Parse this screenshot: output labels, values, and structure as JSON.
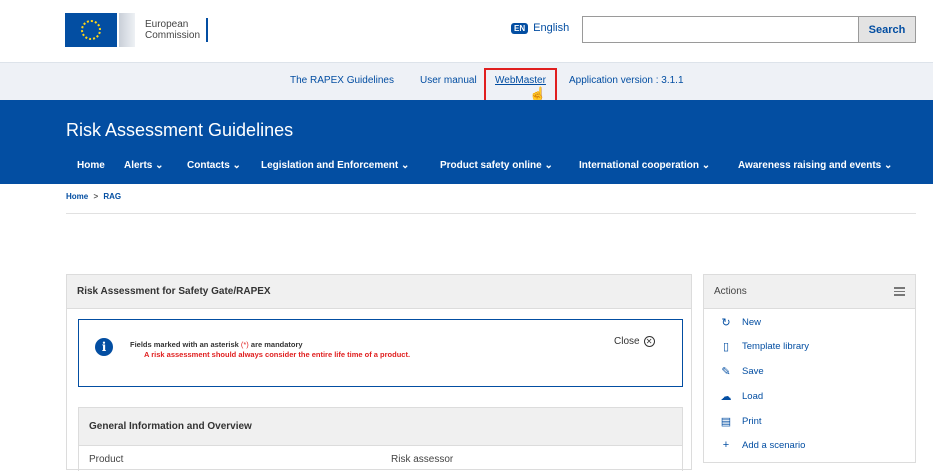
{
  "header": {
    "logo_line1": "European",
    "logo_line2": "Commission",
    "language_badge": "EN",
    "language_label": "English",
    "search_placeholder": "",
    "search_button": "Search"
  },
  "util_bar": {
    "links": [
      "The RAPEX Guidelines",
      "User manual",
      "WebMaster"
    ],
    "version": "Application version : 3.1.1"
  },
  "banner": {
    "title": "Risk Assessment Guidelines",
    "nav": [
      {
        "label": "Home"
      },
      {
        "label": "Alerts ⌄"
      },
      {
        "label": "Contacts ⌄"
      },
      {
        "label": "Legislation and Enforcement ⌄"
      },
      {
        "label": "Product safety online ⌄"
      },
      {
        "label": "International cooperation ⌄"
      },
      {
        "label": "Awareness raising and events ⌄"
      }
    ]
  },
  "breadcrumb": {
    "home": "Home",
    "separator": ">",
    "current": "RAG"
  },
  "main": {
    "panel_title": "Risk Assessment for Safety Gate/RAPEX",
    "info": {
      "line1_prefix": "Fields marked with an asterisk ",
      "asterisk": "(*)",
      "line1_suffix": " are mandatory",
      "line2": "A risk assessment should always consider the entire life time of a product.",
      "close_label": "Close"
    },
    "general": {
      "title": "General Information and Overview",
      "product_label": "Product",
      "assessor_label": "Risk assessor"
    }
  },
  "actions": {
    "title": "Actions",
    "items": [
      {
        "label": "New",
        "icon": "refresh-icon"
      },
      {
        "label": "Template library",
        "icon": "book-icon"
      },
      {
        "label": "Save",
        "icon": "pencil-icon"
      },
      {
        "label": "Load",
        "icon": "cloud-upload-icon"
      },
      {
        "label": "Print",
        "icon": "print-icon"
      },
      {
        "label": "Add a scenario",
        "icon": "plus-icon"
      }
    ]
  },
  "colors": {
    "brand_blue": "#034ea2",
    "highlight_red": "#e01f1f",
    "alert_red": "#e01f1f"
  }
}
